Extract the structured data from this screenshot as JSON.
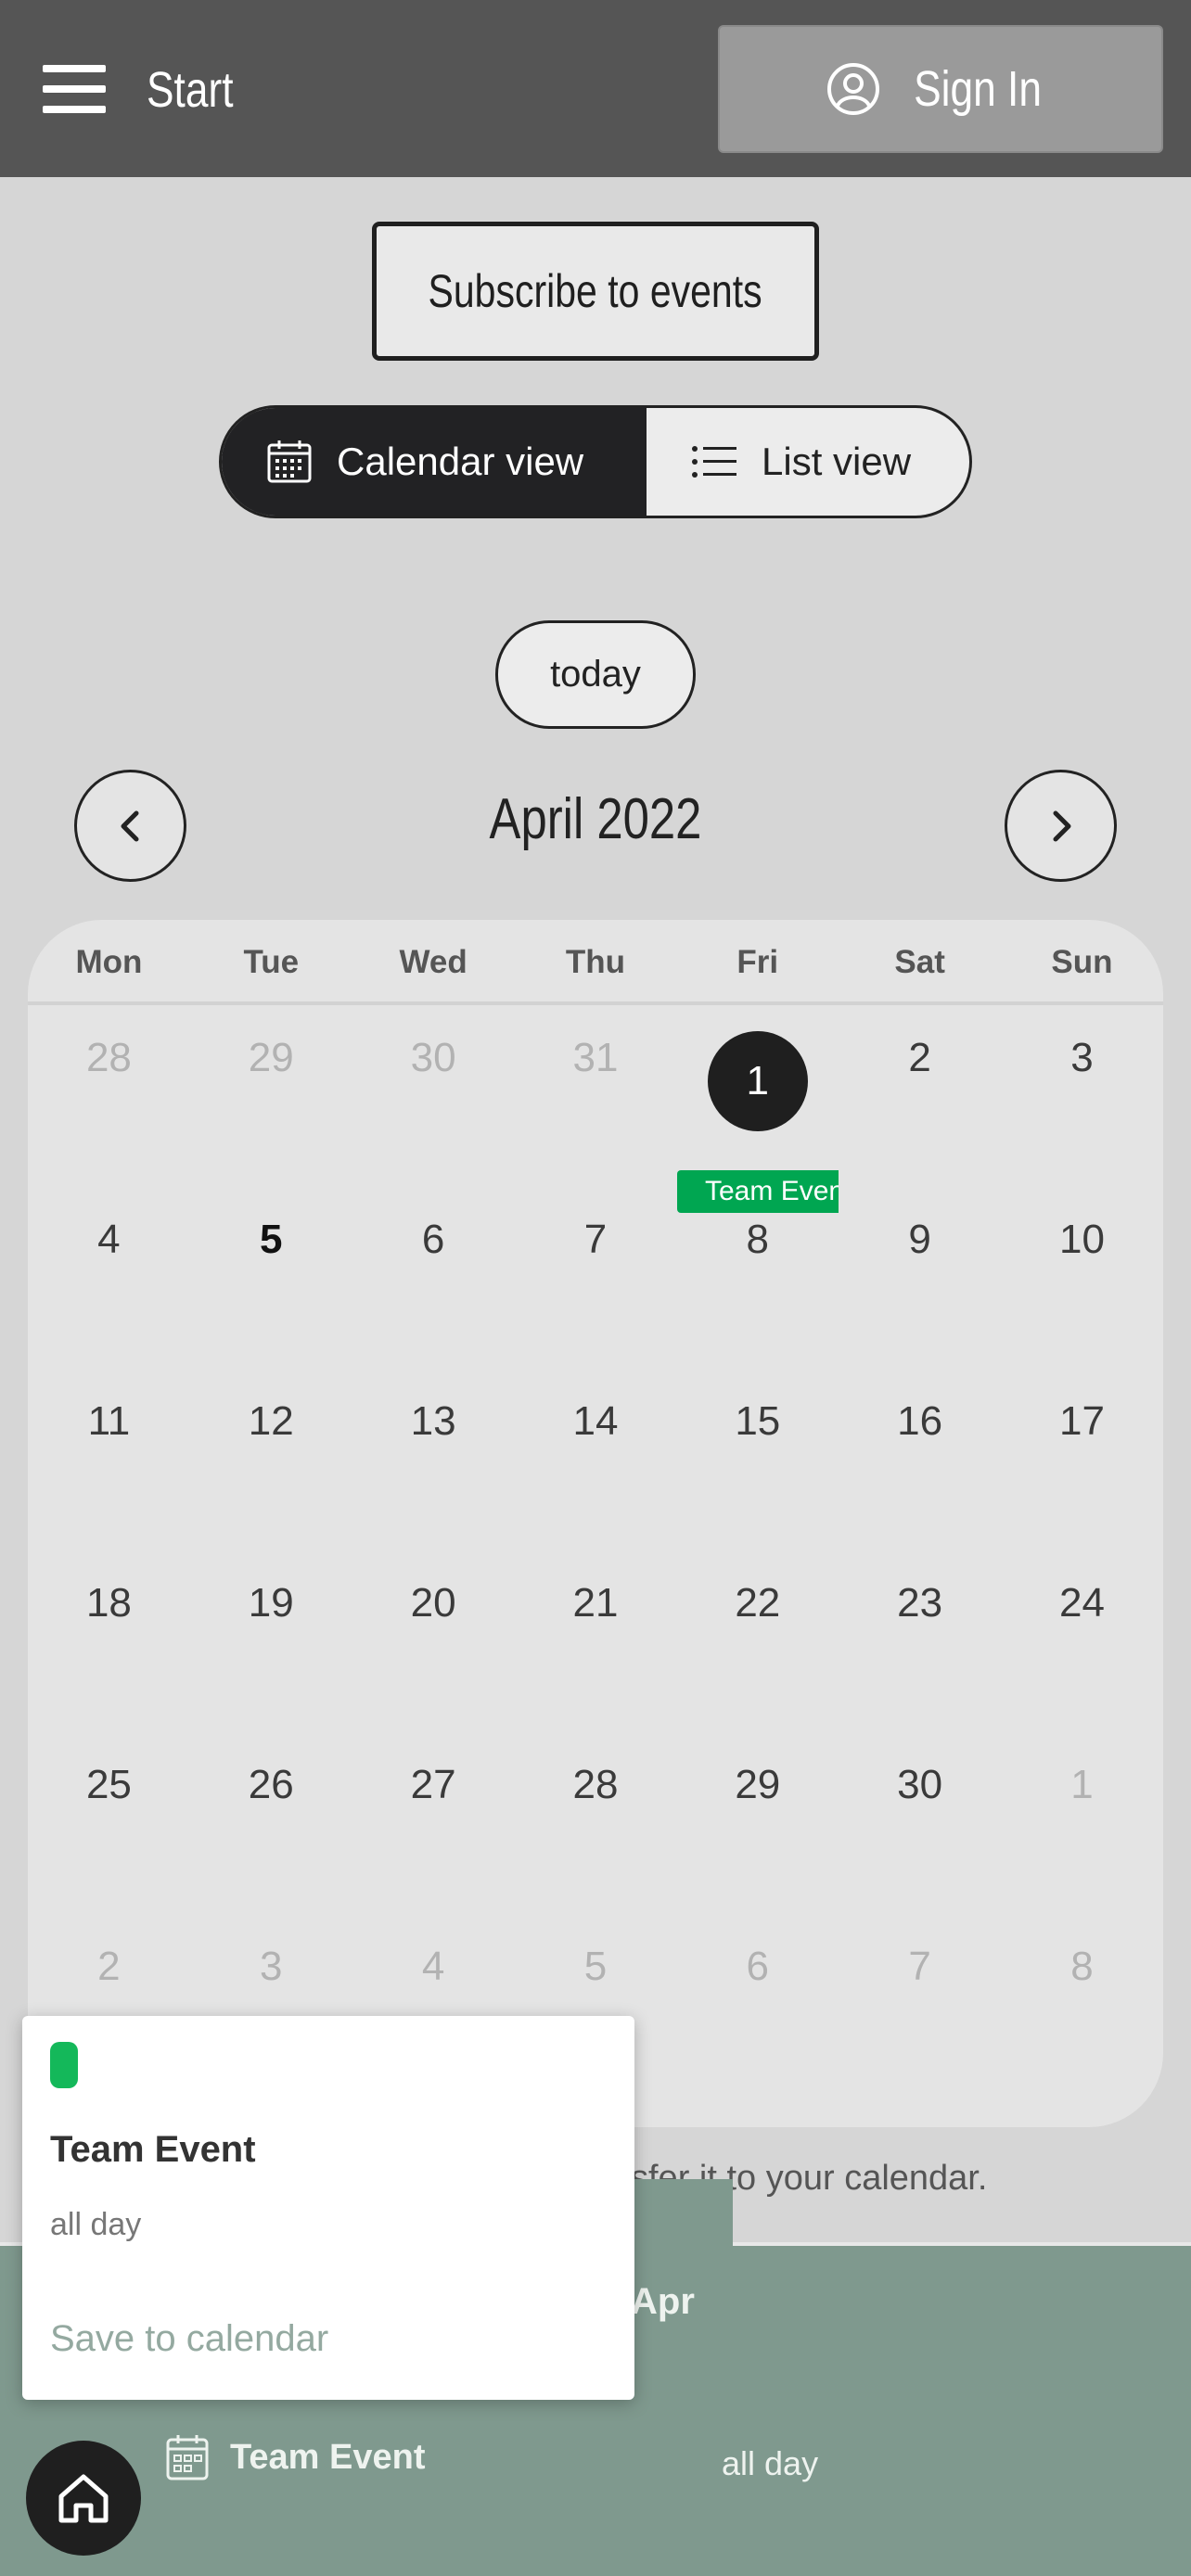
{
  "header": {
    "start_label": "Start",
    "signin_label": "Sign In"
  },
  "subscribe_label": "Subscribe to events",
  "view_toggle": {
    "calendar_label": "Calendar view",
    "list_label": "List view",
    "active": "calendar"
  },
  "today_label": "today",
  "month_title": "April 2022",
  "calendar": {
    "weekdays": [
      "Mon",
      "Tue",
      "Wed",
      "Thu",
      "Fri",
      "Sat",
      "Sun"
    ],
    "weeks": [
      [
        "28",
        "29",
        "30",
        "31",
        "1",
        "2",
        "3"
      ],
      [
        "4",
        "5",
        "6",
        "7",
        "8",
        "9",
        "10"
      ],
      [
        "11",
        "12",
        "13",
        "14",
        "15",
        "16",
        "17"
      ],
      [
        "18",
        "19",
        "20",
        "21",
        "22",
        "23",
        "24"
      ],
      [
        "25",
        "26",
        "27",
        "28",
        "29",
        "30",
        "1"
      ],
      [
        "2",
        "3",
        "4",
        "5",
        "6",
        "7",
        "8"
      ]
    ],
    "selected_day": "1",
    "today_day": "5",
    "event_label": "Team Even"
  },
  "info_text": "sfer it to your calendar.",
  "list": {
    "date_header": "Apr",
    "event_title": "Team Event",
    "event_time": "all day"
  },
  "popup": {
    "title": "Team Event",
    "time": "all day",
    "save_label": "Save to calendar",
    "color": "#14b85a"
  },
  "colors": {
    "header_bg": "#555555",
    "accent_dark": "#1f1f1f",
    "event_green": "#00a651",
    "footer_bg": "#7f998e"
  }
}
